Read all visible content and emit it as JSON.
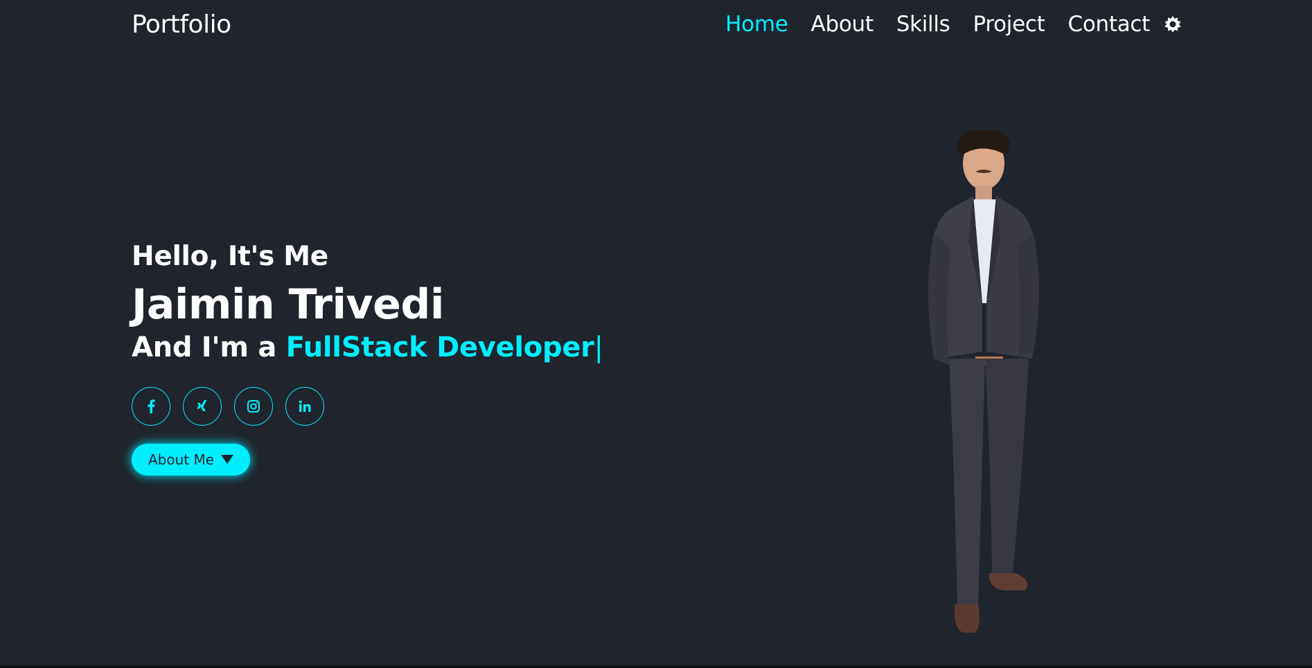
{
  "header": {
    "logo": "Portfolio",
    "nav": [
      {
        "label": "Home",
        "active": true
      },
      {
        "label": "About",
        "active": false
      },
      {
        "label": "Skills",
        "active": false
      },
      {
        "label": "Project",
        "active": false
      },
      {
        "label": "Contact",
        "active": false
      }
    ],
    "theme_toggle_icon": "sun-gear-icon"
  },
  "hero": {
    "greeting": "Hello, It's Me",
    "name": "Jaimin Trivedi",
    "role_prefix": "And I'm a",
    "role_highlight": "FullStack Developer",
    "cursor": "|",
    "socials": [
      {
        "icon": "facebook-icon"
      },
      {
        "icon": "xing-icon"
      },
      {
        "icon": "instagram-icon"
      },
      {
        "icon": "linkedin-icon"
      }
    ],
    "cta_label": "About Me"
  },
  "colors": {
    "background": "#1f242d",
    "accent": "#00eeff",
    "text": "#ffffff"
  }
}
